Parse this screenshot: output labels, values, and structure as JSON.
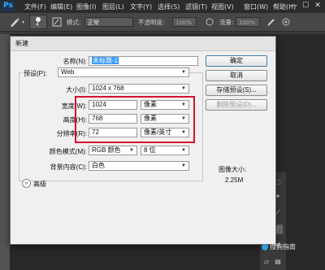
{
  "app": {
    "logo": "Ps",
    "menu": [
      "文件(F)",
      "编辑(E)",
      "图像(I)",
      "图层(L)",
      "文字(Y)",
      "选择(S)",
      "滤镜(T)",
      "视图(V)",
      "窗口(W)",
      "帮助(H)"
    ],
    "window_controls": [
      "—",
      "☐",
      "✕"
    ]
  },
  "options": {
    "brush_size": "4",
    "mode_label": "模式:",
    "mode_value": "正常",
    "opacity_label": "不透明度:",
    "opacity_value": "100%",
    "flow_label": "流量:",
    "flow_value": "100%"
  },
  "dialog": {
    "title": "新建",
    "name_label": "名称(N):",
    "name_value": "未标题-1",
    "preset_label": "预设(P):",
    "preset_value": "Web",
    "size_label": "大小(I):",
    "size_value": "1024 x 768",
    "width_label": "宽度(W):",
    "width_value": "1024",
    "width_unit": "像素",
    "height_label": "高度(H):",
    "height_value": "768",
    "height_unit": "像素",
    "resolution_label": "分辨率(R):",
    "resolution_value": "72",
    "resolution_unit": "像素/英寸",
    "color_mode_label": "颜色模式(M):",
    "color_mode_value": "RGB 颜色",
    "bit_depth_value": "8 位",
    "bg_label": "背景内容(C):",
    "bg_value": "白色",
    "advanced_label": "高级",
    "ok_button": "确定",
    "cancel_button": "取消",
    "save_preset_button": "存储预设(S)...",
    "delete_preset_button": "删除预设(D)...",
    "image_size_label": "图像大小:",
    "image_size_value": "2.25M"
  },
  "watermark": "搜狗指南",
  "colors": {
    "accent_highlight": "#d8102a",
    "selection": "#3399ff"
  }
}
